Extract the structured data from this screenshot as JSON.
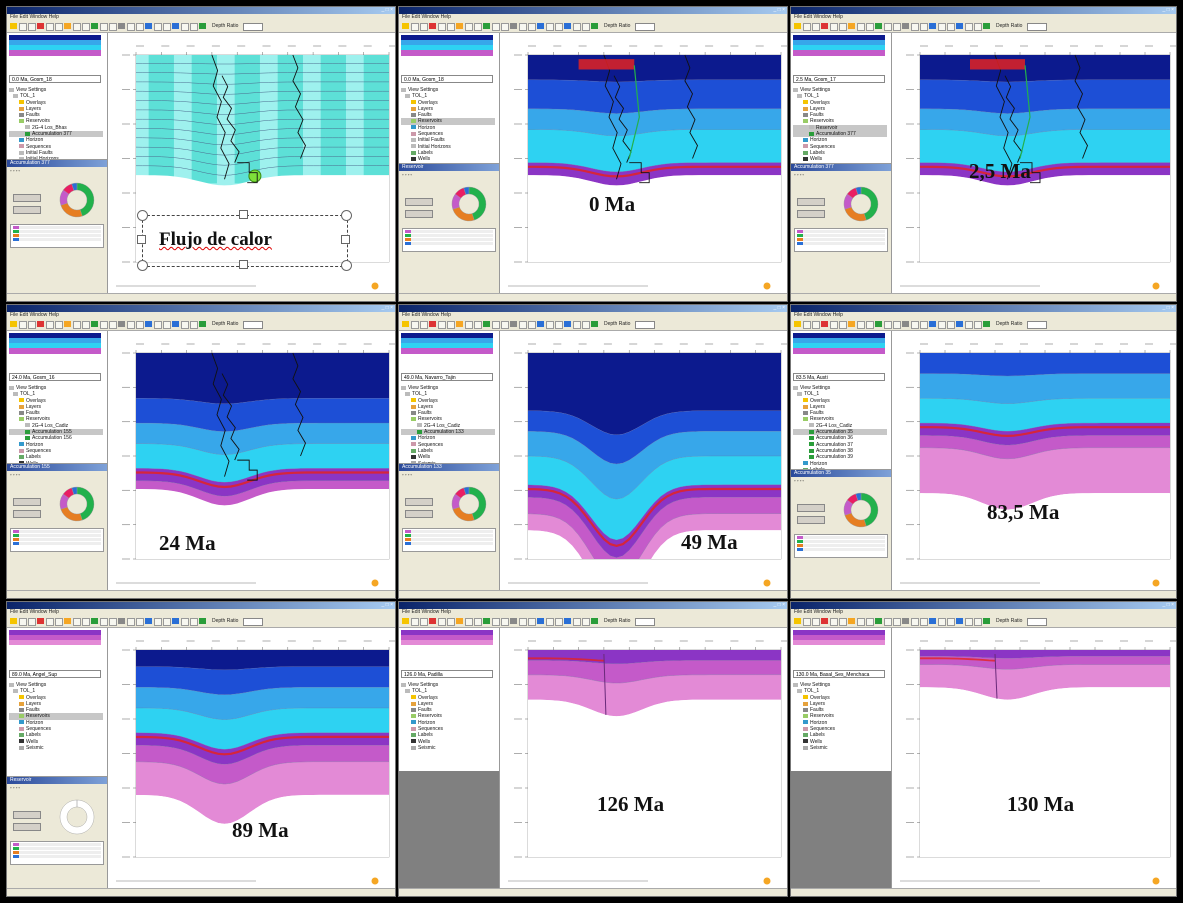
{
  "app": {
    "menu": "File  Edit  Window  Help",
    "depth_label": "Depth Ratio"
  },
  "heat_flow_label": "Flujo de calor",
  "colors": {
    "sea_dark": "#0c1a8e",
    "sea_mid": "#1d4fd6",
    "sea_light": "#37a7ea",
    "cyan": "#2ed2f2",
    "purple": "#8b35c5",
    "magenta": "#c45ac9",
    "pink": "#e38ad6",
    "red": "#e32222",
    "green": "#22b14c",
    "heat_teal": "#32d6c8",
    "heat_light": "#9ef1ee"
  },
  "panels": [
    {
      "id": "p1",
      "time_label": "",
      "heat": true,
      "accumulation_title": "Accumulation 377",
      "model": "0.0 Ma, Gosm_18",
      "tree": [
        "View Settings",
        "TOL_1",
        "Overlays",
        "Layers",
        "Faults",
        "Reservoirs",
        "2G-4 Los_Bhas",
        "Accumulation 377",
        "Horizon",
        "Sequences",
        "Initial Faults",
        "Initial Horizons",
        "Labels",
        "Wells",
        "Seismic"
      ]
    },
    {
      "id": "p2",
      "time_label": "0 Ma",
      "heat": false,
      "accumulation_title": "Reservoir",
      "model": "0.0 Ma, Gosm_18",
      "tree": [
        "View Settings",
        "TOL_1",
        "Overlays",
        "Layers",
        "Faults",
        "Reservoirs",
        "Horizon",
        "Sequences",
        "Initial Faults",
        "Initial Horizons",
        "Labels",
        "Wells",
        "Seismic"
      ]
    },
    {
      "id": "p3",
      "time_label": "2,5 Ma",
      "heat": false,
      "accumulation_title": "Accumulation 377",
      "model": "2.5 Ma, Gosm_17",
      "tree": [
        "View Settings",
        "TOL_1",
        "Overlays",
        "Layers",
        "Faults",
        "Reservoirs",
        "Reservoir",
        "Accumulation 377",
        "Horizon",
        "Sequences",
        "Labels",
        "Wells",
        "Seismic"
      ]
    },
    {
      "id": "p4",
      "time_label": "24 Ma",
      "heat": false,
      "accumulation_title": "Accumulation 155",
      "model": "24.0 Ma, Gosm_16",
      "tree": [
        "View Settings",
        "TOL_1",
        "Overlays",
        "Layers",
        "Faults",
        "Reservoirs",
        "2G-4 Los_Cadiz",
        "Accumulation 155",
        "Accumulation 156",
        "Horizon",
        "Sequences",
        "Labels",
        "Wells",
        "Seismic"
      ]
    },
    {
      "id": "p5",
      "time_label": "49 Ma",
      "heat": false,
      "accumulation_title": "Accumulation 133",
      "model": "49.0 Ma, Navarro_Tajin",
      "tree": [
        "View Settings",
        "TOL_1",
        "Overlays",
        "Layers",
        "Faults",
        "Reservoirs",
        "2G-4 Los_Cadiz",
        "Accumulation 133",
        "Horizon",
        "Sequences",
        "Labels",
        "Wells",
        "Seismic"
      ]
    },
    {
      "id": "p6",
      "time_label": "83,5 Ma",
      "heat": false,
      "accumulation_title": "Accumulation 35",
      "model": "83.5 Ma, Austi",
      "tree": [
        "View Settings",
        "TOL_1",
        "Overlays",
        "Layers",
        "Faults",
        "Reservoirs",
        "2G-4 Los_Cadiz",
        "Accumulation 35",
        "Accumulation 36",
        "Accumulation 37",
        "Accumulation 38",
        "Accumulation 39",
        "Horizon",
        "Labels",
        "Wells",
        "Seismic"
      ]
    },
    {
      "id": "p7",
      "time_label": "89 Ma",
      "heat": false,
      "accumulation_title": "Reservoir",
      "model": "89.0 Ma, Angel_Sup",
      "tree": [
        "View Settings",
        "TOL_1",
        "Overlays",
        "Layers",
        "Faults",
        "Reservoirs",
        "Horizon",
        "Sequences",
        "Labels",
        "Wells",
        "Seismic"
      ]
    },
    {
      "id": "p8",
      "time_label": "126 Ma",
      "heat": false,
      "accumulation_title": "",
      "model": "126.0 Ma, Padilla",
      "tree": [
        "View Settings",
        "TOL_1",
        "Overlays",
        "Layers",
        "Faults",
        "Reservoirs",
        "Horizon",
        "Sequences",
        "Labels",
        "Wells",
        "Seismic"
      ]
    },
    {
      "id": "p9",
      "time_label": "130 Ma",
      "heat": false,
      "accumulation_title": "",
      "model": "130.0 Ma, Basal_Ses_Menchaca",
      "tree": [
        "View Settings",
        "TOL_1",
        "Overlays",
        "Layers",
        "Faults",
        "Reservoirs",
        "Horizon",
        "Sequences",
        "Labels",
        "Wells",
        "Seismic"
      ]
    }
  ]
}
